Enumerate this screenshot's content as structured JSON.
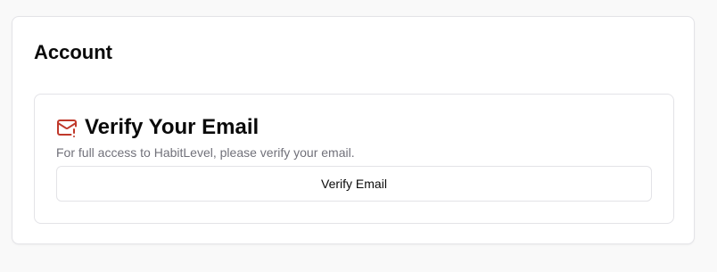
{
  "account": {
    "title": "Account"
  },
  "verify_email": {
    "icon": "mail-warning-icon",
    "icon_color": "#c0392b",
    "title": "Verify Your Email",
    "description": "For full access to HabitLevel, please verify your email.",
    "button_label": "Verify Email"
  }
}
